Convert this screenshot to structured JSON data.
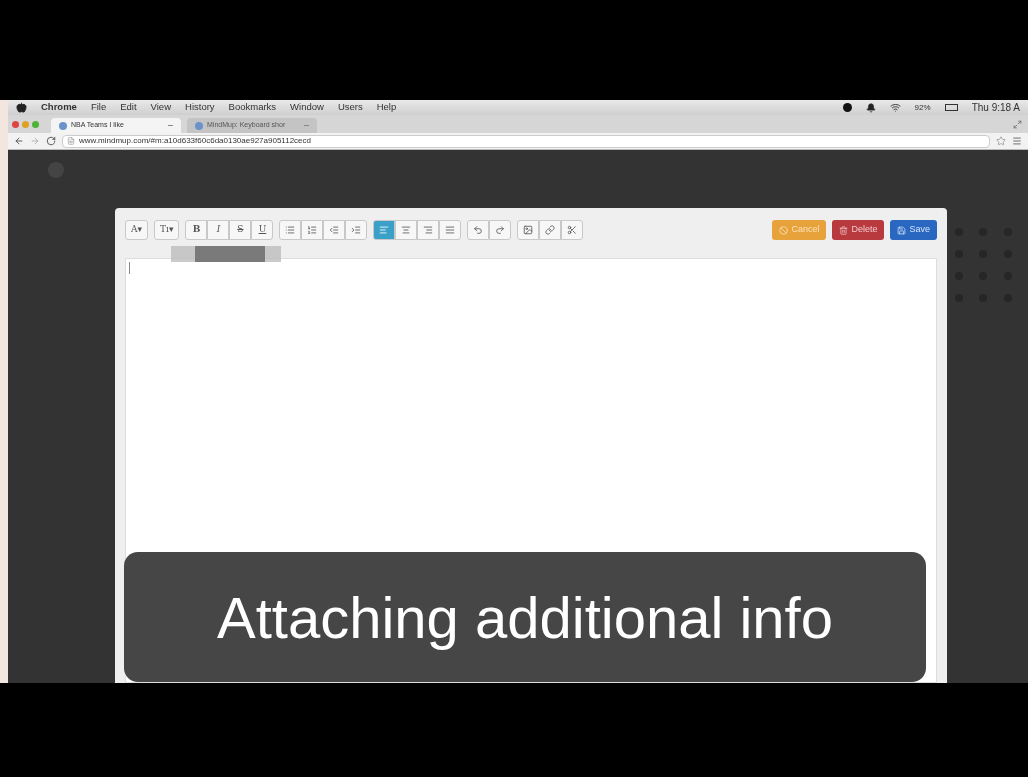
{
  "menu_bar": {
    "items": [
      "Chrome",
      "File",
      "Edit",
      "View",
      "History",
      "Bookmarks",
      "Window",
      "Users",
      "Help"
    ],
    "battery": "92%",
    "clock": "Thu 9:18 A"
  },
  "tabs": [
    {
      "label": "NBA Teams I like",
      "selected": true
    },
    {
      "label": "MindMup: Keyboard shor",
      "selected": false
    }
  ],
  "address": "www.mindmup.com/#m:a10d633f60c6da0130ae927a905112cecd",
  "editor": {
    "toolbar": [
      [
        {
          "kind": "text",
          "label": "A▾",
          "selected": false
        }
      ],
      [
        {
          "kind": "text",
          "label": "Tı▾",
          "selected": false
        }
      ],
      [
        {
          "kind": "text",
          "label": "B",
          "selected": false
        },
        {
          "kind": "text",
          "label": "I",
          "selected": false
        },
        {
          "kind": "text",
          "label": "S",
          "selected": false
        },
        {
          "kind": "text",
          "label": "U",
          "selected": false
        }
      ],
      [
        {
          "kind": "icon",
          "selected": false
        },
        {
          "kind": "icon",
          "selected": false
        },
        {
          "kind": "icon",
          "selected": false
        },
        {
          "kind": "icon",
          "selected": false
        }
      ],
      [
        {
          "kind": "icon",
          "selected": true
        },
        {
          "kind": "icon",
          "selected": false
        },
        {
          "kind": "icon",
          "selected": false
        },
        {
          "kind": "icon",
          "selected": false
        }
      ],
      [
        {
          "kind": "icon",
          "selected": false
        },
        {
          "kind": "icon",
          "selected": false
        }
      ],
      [
        {
          "kind": "icon",
          "selected": false
        },
        {
          "kind": "icon",
          "selected": false
        },
        {
          "kind": "icon",
          "selected": false
        }
      ]
    ],
    "buttons": [
      {
        "label": "Cancel",
        "kind": "warning"
      },
      {
        "label": "Delete",
        "kind": "danger"
      },
      {
        "label": "Save",
        "kind": "primary"
      }
    ]
  },
  "caption": "Attaching additional info"
}
